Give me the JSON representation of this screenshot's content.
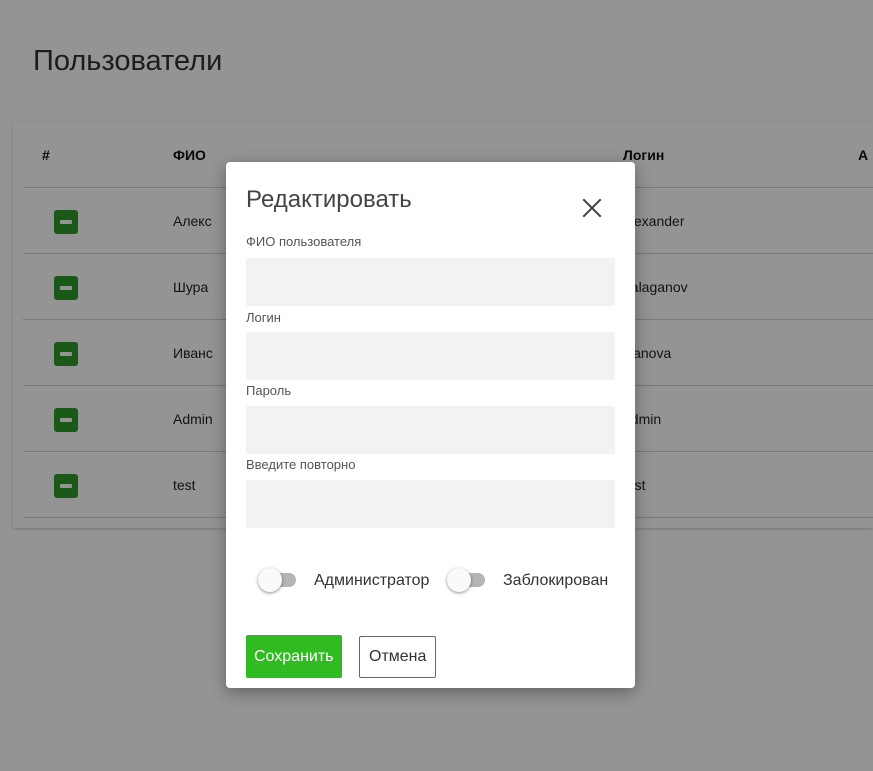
{
  "page": {
    "title": "Пользователи"
  },
  "table": {
    "headers": {
      "num": "#",
      "name": "ФИО",
      "login": "Логин",
      "extra": "А"
    },
    "rows": [
      {
        "name": "Алекс",
        "login": "alexander"
      },
      {
        "name": "Шура",
        "login": "balaganov"
      },
      {
        "name": "Иванс",
        "login": "ivanova"
      },
      {
        "name": "Admin",
        "login": "admin"
      },
      {
        "name": "test",
        "login": "test"
      }
    ]
  },
  "modal": {
    "title": "Редактировать",
    "fields": {
      "fullname": {
        "label": "ФИО пользователя",
        "value": ""
      },
      "login": {
        "label": "Логин",
        "value": ""
      },
      "password": {
        "label": "Пароль",
        "value": ""
      },
      "password_repeat": {
        "label": "Введите повторно",
        "value": ""
      }
    },
    "toggles": {
      "admin": {
        "label": "Администратор",
        "checked": false
      },
      "blocked": {
        "label": "Заблокирован",
        "checked": false
      }
    },
    "save_label": "Сохранить",
    "cancel_label": "Отмена"
  },
  "colors": {
    "row_button": "#2f9a2b",
    "save_button": "#2fbb21",
    "input_background": "#f2f2f2"
  },
  "icons": {
    "row_action": "minus-icon",
    "close": "close-icon"
  }
}
